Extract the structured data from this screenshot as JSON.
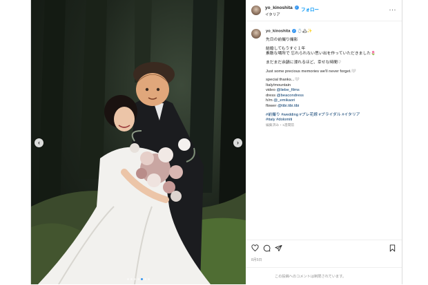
{
  "post": {
    "username": "yo_kinoshita",
    "follow_label": "フォロー",
    "location": "イタリア",
    "verified_mark": "✓",
    "more_label": "···",
    "caption_username": "yo_kinoshita",
    "caption_emoji": "💍🏔✨",
    "lines": {
      "l1": "先日の前撮り撮影",
      "l2": "結婚してもうすぐ１年",
      "l3": "素敵な場所で 忘れられない思い出を作っていただきました🌷",
      "l4": "まだまだ余韻に浸れるほど、幸せな時間♡",
      "l5": "Just some precious memories we'll never forget.🤍",
      "l6": "special thanks...🤍",
      "l7": "Italy/mountain",
      "l8_prefix": "video ",
      "l8_link": "@liebe_films",
      "l9_prefix": "dress ",
      "l9_link": "@beacondress",
      "l10_prefix": "h/m ",
      "l10_link": "@_emikaori",
      "l11_prefix": "flower ",
      "l11_link": "@tibi.tibi.tibi",
      "tags1": "#前撮り #wedding #プレ花嫁 #ブライダル #イタリア",
      "tags2": "#italy #dolomiti",
      "meta": "編集済み・1週間前"
    },
    "date": "8月5日",
    "comment_placeholder": "この投稿へのコメントは制限されています。",
    "carousel": {
      "slides": 7,
      "active_index": 4
    }
  },
  "icons": {
    "prev": "chevron-left-icon",
    "next": "chevron-right-icon",
    "like": "heart-icon",
    "comment": "comment-icon",
    "share": "paper-plane-icon",
    "save": "bookmark-icon"
  },
  "colors": {
    "link": "#00376b",
    "follow": "#0095f6",
    "active_dot": "#3897f0"
  }
}
